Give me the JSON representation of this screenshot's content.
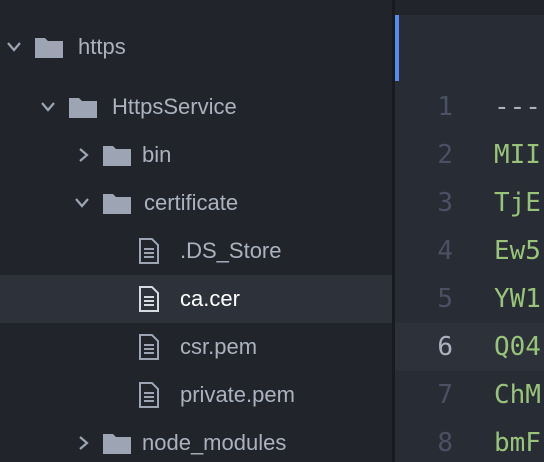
{
  "tree": {
    "items": [
      {
        "label": "https",
        "kind": "folder",
        "expanded": true
      },
      {
        "label": "HttpsService",
        "kind": "folder",
        "expanded": true
      },
      {
        "label": "bin",
        "kind": "folder",
        "expanded": false
      },
      {
        "label": "certificate",
        "kind": "folder",
        "expanded": true
      },
      {
        "label": ".DS_Store",
        "kind": "file"
      },
      {
        "label": "ca.cer",
        "kind": "file",
        "selected": true
      },
      {
        "label": "csr.pem",
        "kind": "file"
      },
      {
        "label": "private.pem",
        "kind": "file"
      },
      {
        "label": "node_modules",
        "kind": "folder",
        "expanded": false
      }
    ]
  },
  "editor": {
    "active_line": 6,
    "lines": [
      {
        "num": "1",
        "text": "---"
      },
      {
        "num": "2",
        "text": "MII"
      },
      {
        "num": "3",
        "text": "TjE"
      },
      {
        "num": "4",
        "text": "Ew5"
      },
      {
        "num": "5",
        "text": "YW1"
      },
      {
        "num": "6",
        "text": "Q04"
      },
      {
        "num": "7",
        "text": "ChM"
      },
      {
        "num": "8",
        "text": "bmF"
      }
    ]
  },
  "colors": {
    "sidebar_bg": "#21252b",
    "editor_bg": "#282c34",
    "selection_bg": "#2c313a",
    "tree_text": "#abb2bf",
    "code_string": "#98c379",
    "line_number": "#495162",
    "accent": "#568af2"
  },
  "icons": {
    "folder": "folder-icon",
    "file": "file-text-icon",
    "expanded": "chevron-down-icon",
    "collapsed": "chevron-right-icon"
  }
}
